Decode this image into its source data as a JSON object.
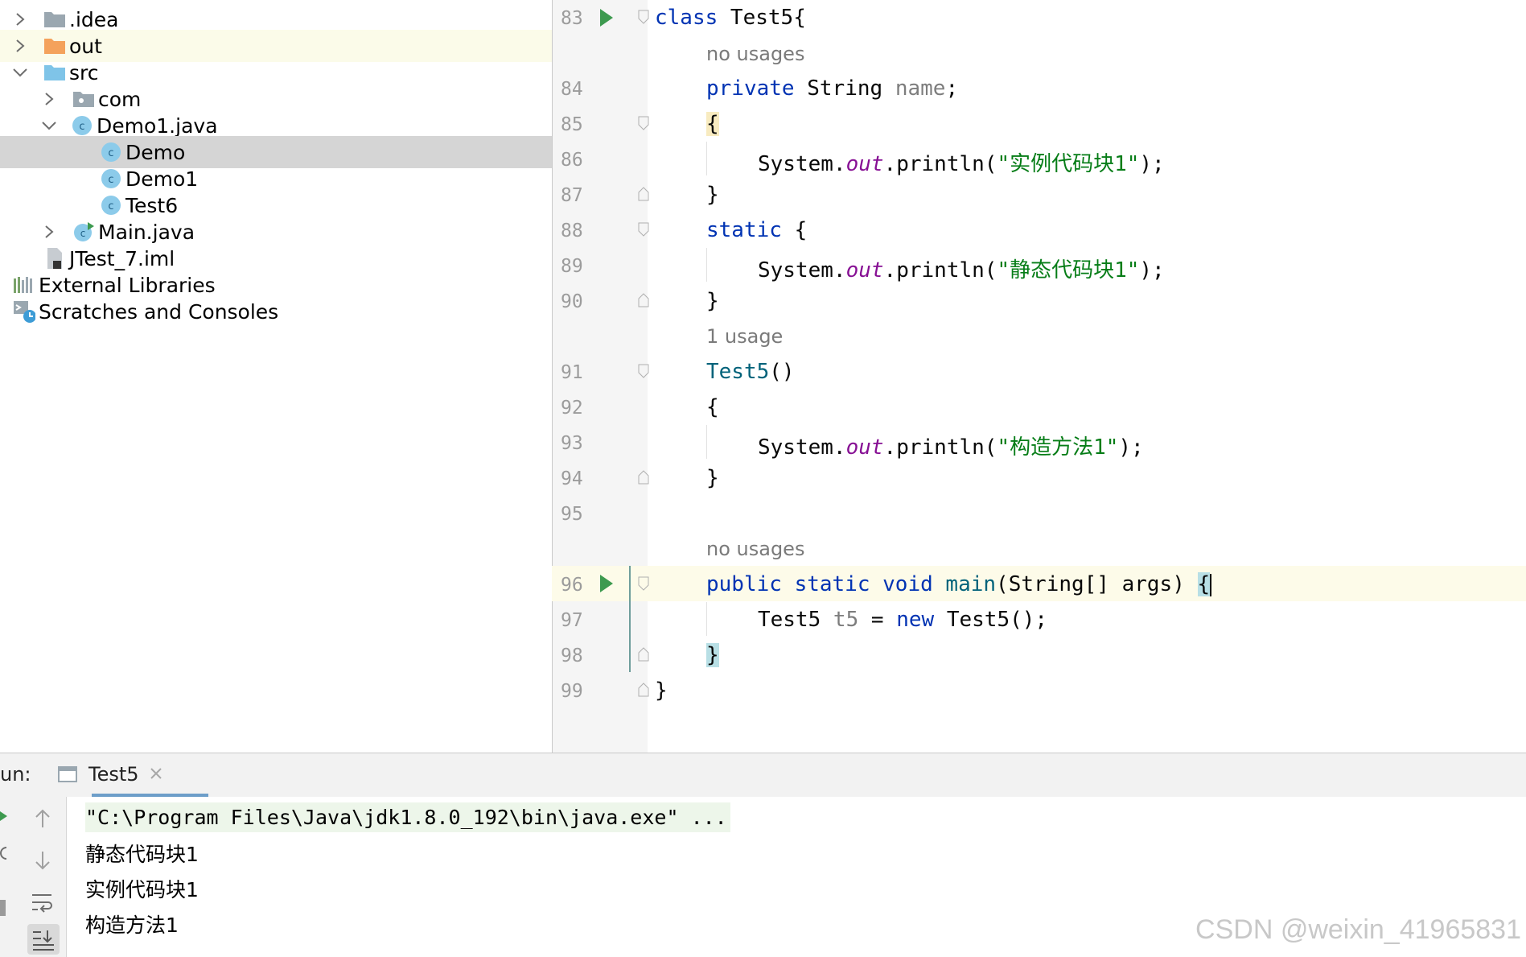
{
  "project_tree": {
    "items": [
      {
        "label": ".idea",
        "icon": "folder-icon"
      },
      {
        "label": "out",
        "icon": "folder-orange-icon"
      },
      {
        "label": "src",
        "icon": "source-folder-icon"
      },
      {
        "label": "com",
        "icon": "package-icon"
      },
      {
        "label": "Demo1.java",
        "icon": "java-class-icon"
      },
      {
        "label": "Demo",
        "icon": "java-class-icon"
      },
      {
        "label": "Demo1",
        "icon": "java-class-icon"
      },
      {
        "label": "Test6",
        "icon": "java-class-icon"
      },
      {
        "label": "Main.java",
        "icon": "java-class-runnable-icon"
      },
      {
        "label": "JTest_7.iml",
        "icon": "iml-file-icon"
      },
      {
        "label": "External Libraries",
        "icon": "libraries-icon"
      },
      {
        "label": "Scratches and Consoles",
        "icon": "scratches-icon"
      }
    ]
  },
  "editor": {
    "line_numbers": [
      "83",
      "84",
      "85",
      "86",
      "87",
      "88",
      "89",
      "90",
      "91",
      "92",
      "93",
      "94",
      "95",
      "96",
      "97",
      "98",
      "99"
    ],
    "hints": {
      "no_usages_1": "no usages",
      "one_usage": "1 usage",
      "no_usages_2": "no usages"
    },
    "code": {
      "l83_kw": "class",
      "l83_rest": " Test5{",
      "l84_kw": "private",
      "l84_type": " String ",
      "l84_name": "name",
      "l84_end": ";",
      "l85": "{",
      "l86_a": "System.",
      "l86_b": "out",
      "l86_c": ".println(",
      "l86_str": "\"实例代码块1\"",
      "l86_end": ");",
      "l87": "}",
      "l88_kw": "static",
      "l88_rest": " {",
      "l89_a": "System.",
      "l89_b": "out",
      "l89_c": ".println(",
      "l89_str": "\"静态代码块1\"",
      "l89_end": ");",
      "l90": "}",
      "l91_fn": "Test5",
      "l91_rest": "()",
      "l92": "{",
      "l93_a": "System.",
      "l93_b": "out",
      "l93_c": ".println(",
      "l93_str": "\"构造方法1\"",
      "l93_end": ");",
      "l94": "}",
      "l96_kw": "public static void ",
      "l96_fn": "main",
      "l96_rest": "(String[] args) ",
      "l96_brace": "{",
      "l97_a": "Test5 ",
      "l97_var": "t5",
      "l97_b": " = ",
      "l97_kw": "new",
      "l97_c": " Test5();",
      "l98": "}",
      "l99": "}"
    }
  },
  "run_panel": {
    "label": "un:",
    "tab": "Test5",
    "output": [
      "\"C:\\Program Files\\Java\\jdk1.8.0_192\\bin\\java.exe\" ...",
      "静态代码块1",
      "实例代码块1",
      "构造方法1"
    ]
  },
  "watermark": "CSDN @weixin_41965831",
  "colors": {
    "keyword": "#0033b3",
    "string": "#067d17",
    "field": "#871094",
    "run_green": "#3d9a4f"
  }
}
